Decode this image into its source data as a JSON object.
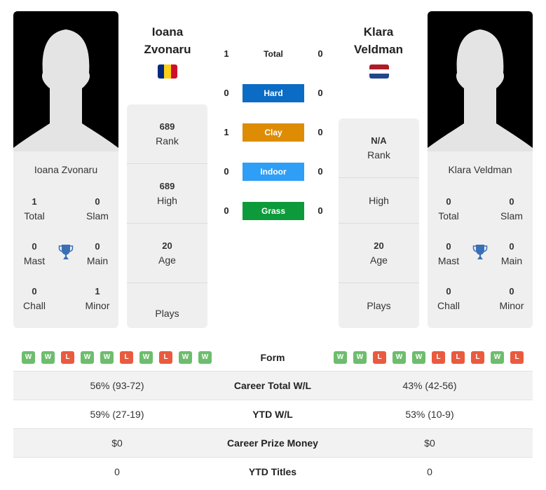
{
  "player1": {
    "name": "Ioana Zvonaru",
    "name_line1": "Ioana",
    "name_line2": "Zvonaru",
    "flag": "romania-flag",
    "flag_colors": [
      "#002B7F",
      "#FCD116",
      "#CE1126"
    ],
    "titles": {
      "total": {
        "value": "1",
        "label": "Total"
      },
      "slam": {
        "value": "0",
        "label": "Slam"
      },
      "mast": {
        "value": "0",
        "label": "Mast"
      },
      "main": {
        "value": "0",
        "label": "Main"
      },
      "chall": {
        "value": "0",
        "label": "Chall"
      },
      "minor": {
        "value": "1",
        "label": "Minor"
      }
    },
    "stats": {
      "rank": {
        "value": "689",
        "label": "Rank"
      },
      "high": {
        "value": "689",
        "label": "High"
      },
      "age": {
        "value": "20",
        "label": "Age"
      },
      "plays": {
        "value": "",
        "label": "Plays"
      }
    },
    "form": [
      "W",
      "W",
      "L",
      "W",
      "W",
      "L",
      "W",
      "L",
      "W",
      "W"
    ]
  },
  "player2": {
    "name": "Klara Veldman",
    "name_line1": "Klara",
    "name_line2": "Veldman",
    "flag": "netherlands-flag",
    "flag_colors": [
      "#AE1C28",
      "#FFFFFF",
      "#21468B"
    ],
    "titles": {
      "total": {
        "value": "0",
        "label": "Total"
      },
      "slam": {
        "value": "0",
        "label": "Slam"
      },
      "mast": {
        "value": "0",
        "label": "Mast"
      },
      "main": {
        "value": "0",
        "label": "Main"
      },
      "chall": {
        "value": "0",
        "label": "Chall"
      },
      "minor": {
        "value": "0",
        "label": "Minor"
      }
    },
    "stats": {
      "rank": {
        "value": "N/A",
        "label": "Rank"
      },
      "high": {
        "value": "",
        "label": "High"
      },
      "age": {
        "value": "20",
        "label": "Age"
      },
      "plays": {
        "value": "",
        "label": "Plays"
      }
    },
    "form": [
      "W",
      "W",
      "L",
      "W",
      "W",
      "L",
      "L",
      "L",
      "W",
      "L"
    ]
  },
  "h2h": [
    {
      "label": "Total",
      "p1": "1",
      "p2": "0",
      "color": ""
    },
    {
      "label": "Hard",
      "p1": "0",
      "p2": "0",
      "color": "#0a6cc4"
    },
    {
      "label": "Clay",
      "p1": "1",
      "p2": "0",
      "color": "#de8c04"
    },
    {
      "label": "Indoor",
      "p1": "0",
      "p2": "0",
      "color": "#2e9ef6"
    },
    {
      "label": "Grass",
      "p1": "0",
      "p2": "0",
      "color": "#0d9a3a"
    }
  ],
  "form_label": "Form",
  "comparison": [
    {
      "label": "Career Total W/L",
      "p1": "56% (93-72)",
      "p2": "43% (42-56)"
    },
    {
      "label": "YTD W/L",
      "p1": "59% (27-19)",
      "p2": "53% (10-9)"
    },
    {
      "label": "Career Prize Money",
      "p1": "$0",
      "p2": "$0"
    },
    {
      "label": "YTD Titles",
      "p1": "0",
      "p2": "0"
    }
  ],
  "colors": {
    "win": "#6dbd6d",
    "loss": "#ea5a3e",
    "trophy": "#3a6fb5"
  }
}
